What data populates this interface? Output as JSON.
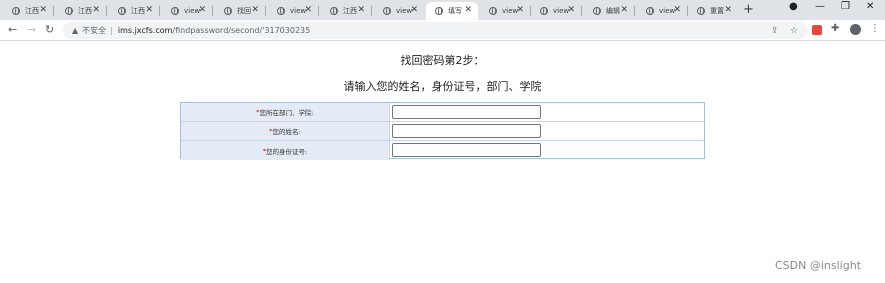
{
  "browser": {
    "tabs": [
      {
        "label": "江西",
        "active": false
      },
      {
        "label": "江西",
        "active": false
      },
      {
        "label": "江西",
        "active": false
      },
      {
        "label": "view",
        "active": false
      },
      {
        "label": "找回",
        "active": false
      },
      {
        "label": "view",
        "active": false
      },
      {
        "label": "江西",
        "active": false
      },
      {
        "label": "view",
        "active": false
      },
      {
        "label": "填写",
        "active": true
      },
      {
        "label": "view",
        "active": false
      },
      {
        "label": "view",
        "active": false
      },
      {
        "label": "编辑",
        "active": false
      },
      {
        "label": "view",
        "active": false
      },
      {
        "label": "重置",
        "active": false
      }
    ],
    "new_tab_label": "+",
    "address": {
      "security_label": "不安全",
      "separator": "|",
      "host": "ims.jxcfs.com",
      "path": "/findpassword/second/'317030235"
    }
  },
  "page": {
    "title": "找回密码第2步：",
    "subtitle": "请输入您的姓名，身份证号，部门、学院",
    "form": {
      "required_mark": "*",
      "fields": [
        {
          "label": "您所在部门、学院:",
          "value": ""
        },
        {
          "label": "您的姓名:",
          "value": ""
        },
        {
          "label": "您的身份证号:",
          "value": ""
        }
      ]
    }
  },
  "watermark": "CSDN @inslight"
}
